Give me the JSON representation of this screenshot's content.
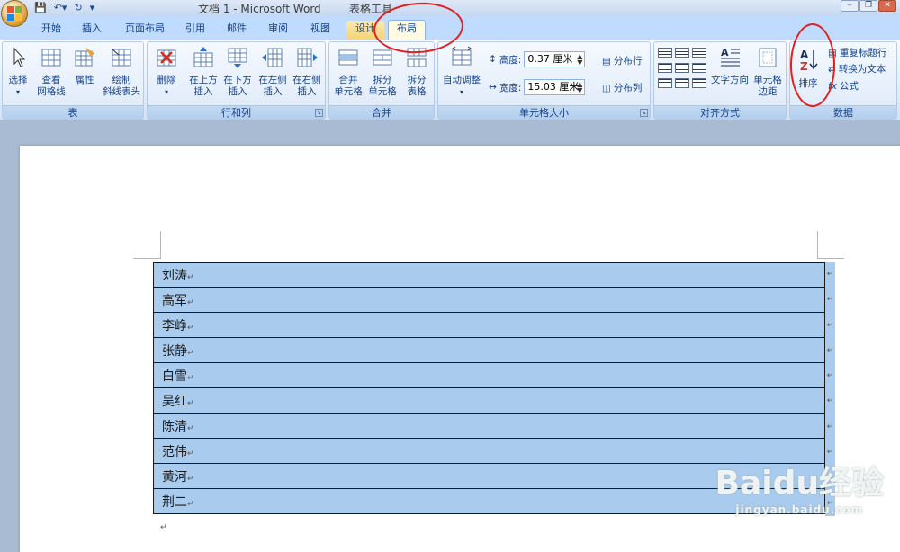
{
  "window": {
    "title": "文档 1 - Microsoft Word",
    "context_label": "表格工具"
  },
  "tabs": [
    "开始",
    "插入",
    "页面布局",
    "引用",
    "邮件",
    "审阅",
    "视图",
    "设计",
    "布局"
  ],
  "active_tab": "布局",
  "ribbon": {
    "table_group": {
      "label": "表",
      "buttons": [
        "选择",
        "查看\n网格线",
        "属性",
        "绘制\n斜线表头"
      ]
    },
    "rows_cols_group": {
      "label": "行和列",
      "buttons": [
        "删除",
        "在上方\n插入",
        "在下方\n插入",
        "在左侧\n插入",
        "在右侧\n插入"
      ]
    },
    "merge_group": {
      "label": "合并",
      "buttons": [
        "合并\n单元格",
        "拆分\n单元格",
        "拆分\n表格"
      ]
    },
    "cell_size_group": {
      "label": "单元格大小",
      "auto_fit": "自动调整",
      "height_label": "高度:",
      "height_value": "0.37 厘米",
      "width_label": "宽度:",
      "width_value": "15.03 厘米",
      "distribute_rows": "分布行",
      "distribute_cols": "分布列"
    },
    "align_group": {
      "label": "对齐方式",
      "text_direction": "文字方向",
      "cell_margins": "单元格\n边距"
    },
    "data_group": {
      "label": "数据",
      "sort": "排序",
      "repeat_header": "重复标题行",
      "convert_to_text": "转换为文本",
      "formula": "公式"
    }
  },
  "document": {
    "rows": [
      "刘涛",
      "高军",
      "李峥",
      "张静",
      "白雪",
      "吴红",
      "陈清",
      "范伟",
      "黄河",
      "荆二"
    ]
  },
  "watermark": {
    "brand": "Baidu经验",
    "url": "jingyan.baidu.com"
  },
  "colors": {
    "ribbon_tab_bg": "#bfdbff",
    "selection": "#a9cbed",
    "annotation": "#e02020"
  }
}
